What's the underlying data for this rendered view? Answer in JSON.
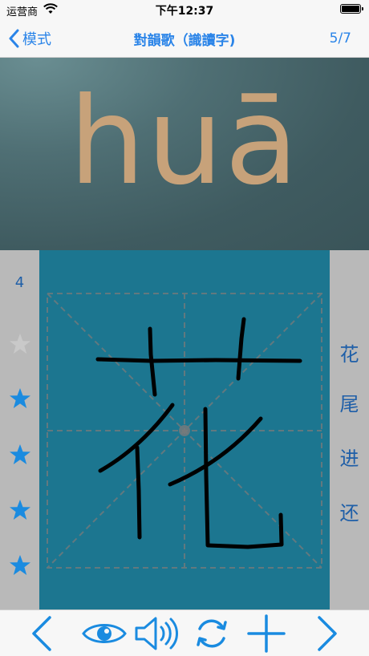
{
  "status_bar": {
    "carrier": "运营商",
    "time": "下午12:37"
  },
  "nav": {
    "back_label": "模式",
    "title": "對韻歌（識讀字)",
    "page": "5/7"
  },
  "pinyin": "huā",
  "character": "花",
  "stroke_count": "4",
  "stars": {
    "total": 5,
    "filled": 4
  },
  "word_list": [
    "花",
    "尾",
    "进",
    "还"
  ],
  "toolbar": {
    "items": [
      "chevron-left-icon",
      "eye-icon",
      "speaker-icon",
      "refresh-icon",
      "plus-icon",
      "chevron-right-icon"
    ]
  },
  "colors": {
    "accent": "#2a84e8",
    "board": "#1c7690",
    "pinyin": "#c7a27a",
    "star_filled": "#1a8be0",
    "star_empty": "#c9c9c9"
  }
}
